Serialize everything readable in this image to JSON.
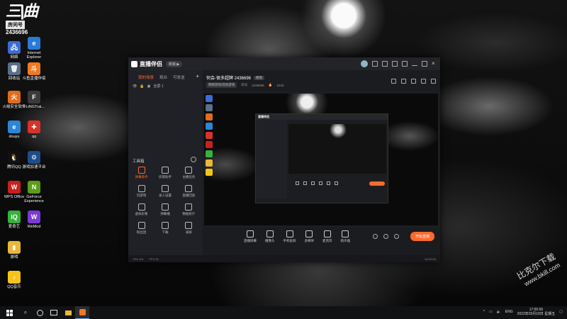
{
  "desktop": {
    "logo": {
      "big": "三|曲",
      "room_label": "房间号",
      "room_number": "2436696"
    },
    "icons": [
      {
        "label": "网络",
        "color": "#3b6bd6",
        "glyph": "🖧"
      },
      {
        "label": "Internet Explorer",
        "color": "#2a7ad6",
        "glyph": "e"
      },
      {
        "label": "回收站",
        "color": "#5b6f86",
        "glyph": "🗑"
      },
      {
        "label": "斗鱼直播伴侣",
        "color": "#f07a22",
        "glyph": "斗"
      },
      {
        "label": "火绒安全软件",
        "color": "#e26b1c",
        "glyph": "火"
      },
      {
        "label": "FLiNGTrai...",
        "color": "#3a3a3a",
        "glyph": "F"
      },
      {
        "label": "douyu",
        "color": "#2c86d8",
        "glyph": "e"
      },
      {
        "label": "qq",
        "color": "#d8322c",
        "glyph": "✚"
      },
      {
        "label": "腾讯QQ",
        "color": "#111111",
        "glyph": "🐧"
      },
      {
        "label": "游戏加速平台",
        "color": "#1d4d8c",
        "glyph": "⚙"
      },
      {
        "label": "WPS Office",
        "color": "#c9201d",
        "glyph": "W"
      },
      {
        "label": "GeForce Experience",
        "color": "#5a9d1a",
        "glyph": "N"
      },
      {
        "label": "爱奇艺",
        "color": "#36b33a",
        "glyph": "iQ"
      },
      {
        "label": "WeMod",
        "color": "#7a3ad6",
        "glyph": "W"
      },
      {
        "label": "游戏",
        "color": "#e8b83a",
        "glyph": "▮"
      },
      {
        "label": "QQ音乐",
        "color": "#f4c418",
        "glyph": "♪"
      }
    ]
  },
  "app": {
    "brand": "直播伴侣",
    "version_pill": "新版 ▶",
    "tabs": [
      {
        "label": "我的场景",
        "active": true
      },
      {
        "label": "观众",
        "active": false
      },
      {
        "label": "可发送",
        "active": false
      }
    ],
    "add_label": "+",
    "scene": {
      "name": "全屏 1"
    },
    "tools_header": "工具箱",
    "tools": [
      {
        "label": "弹幕助手",
        "active": true
      },
      {
        "label": "房管助手",
        "active": false
      },
      {
        "label": "主播任务",
        "active": false
      },
      {
        "label": "玩游戏",
        "active": false
      },
      {
        "label": "录入设置",
        "active": false
      },
      {
        "label": "直播回放",
        "active": false
      },
      {
        "label": "虚拟形象",
        "active": false
      },
      {
        "label": "弹幕播",
        "active": false
      },
      {
        "label": "数据统计",
        "active": false
      },
      {
        "label": "粉丝团",
        "active": false
      },
      {
        "label": "下载",
        "active": false
      },
      {
        "label": "录屏",
        "active": false
      }
    ],
    "room": {
      "title": "何会-很多超牌 2436696",
      "edit": "修改",
      "category": "网络游戏/其他游戏",
      "id_label": "房号",
      "id_value": "2436696",
      "hot_value": "1043"
    },
    "inner_brand": "直播伴侣",
    "bottom_tools": [
      {
        "label": "直播屏幕"
      },
      {
        "label": "摄像头"
      },
      {
        "label": "手机投屏"
      },
      {
        "label": "多媒体"
      },
      {
        "label": "麦克风"
      },
      {
        "label": "扬声器"
      }
    ],
    "start_live": "开始直播",
    "status": {
      "cpu": "CPU 6%",
      "fps": "FPS 30",
      "time": "00:00:00"
    }
  },
  "taskbar": {
    "search_icon": "search-icon",
    "tray": {
      "lang": "ENG",
      "time": "17:00:56",
      "date": "2022年03月18日 星期五"
    }
  },
  "watermark": {
    "text": "比克尔下载",
    "url": "www.bkill.com"
  }
}
